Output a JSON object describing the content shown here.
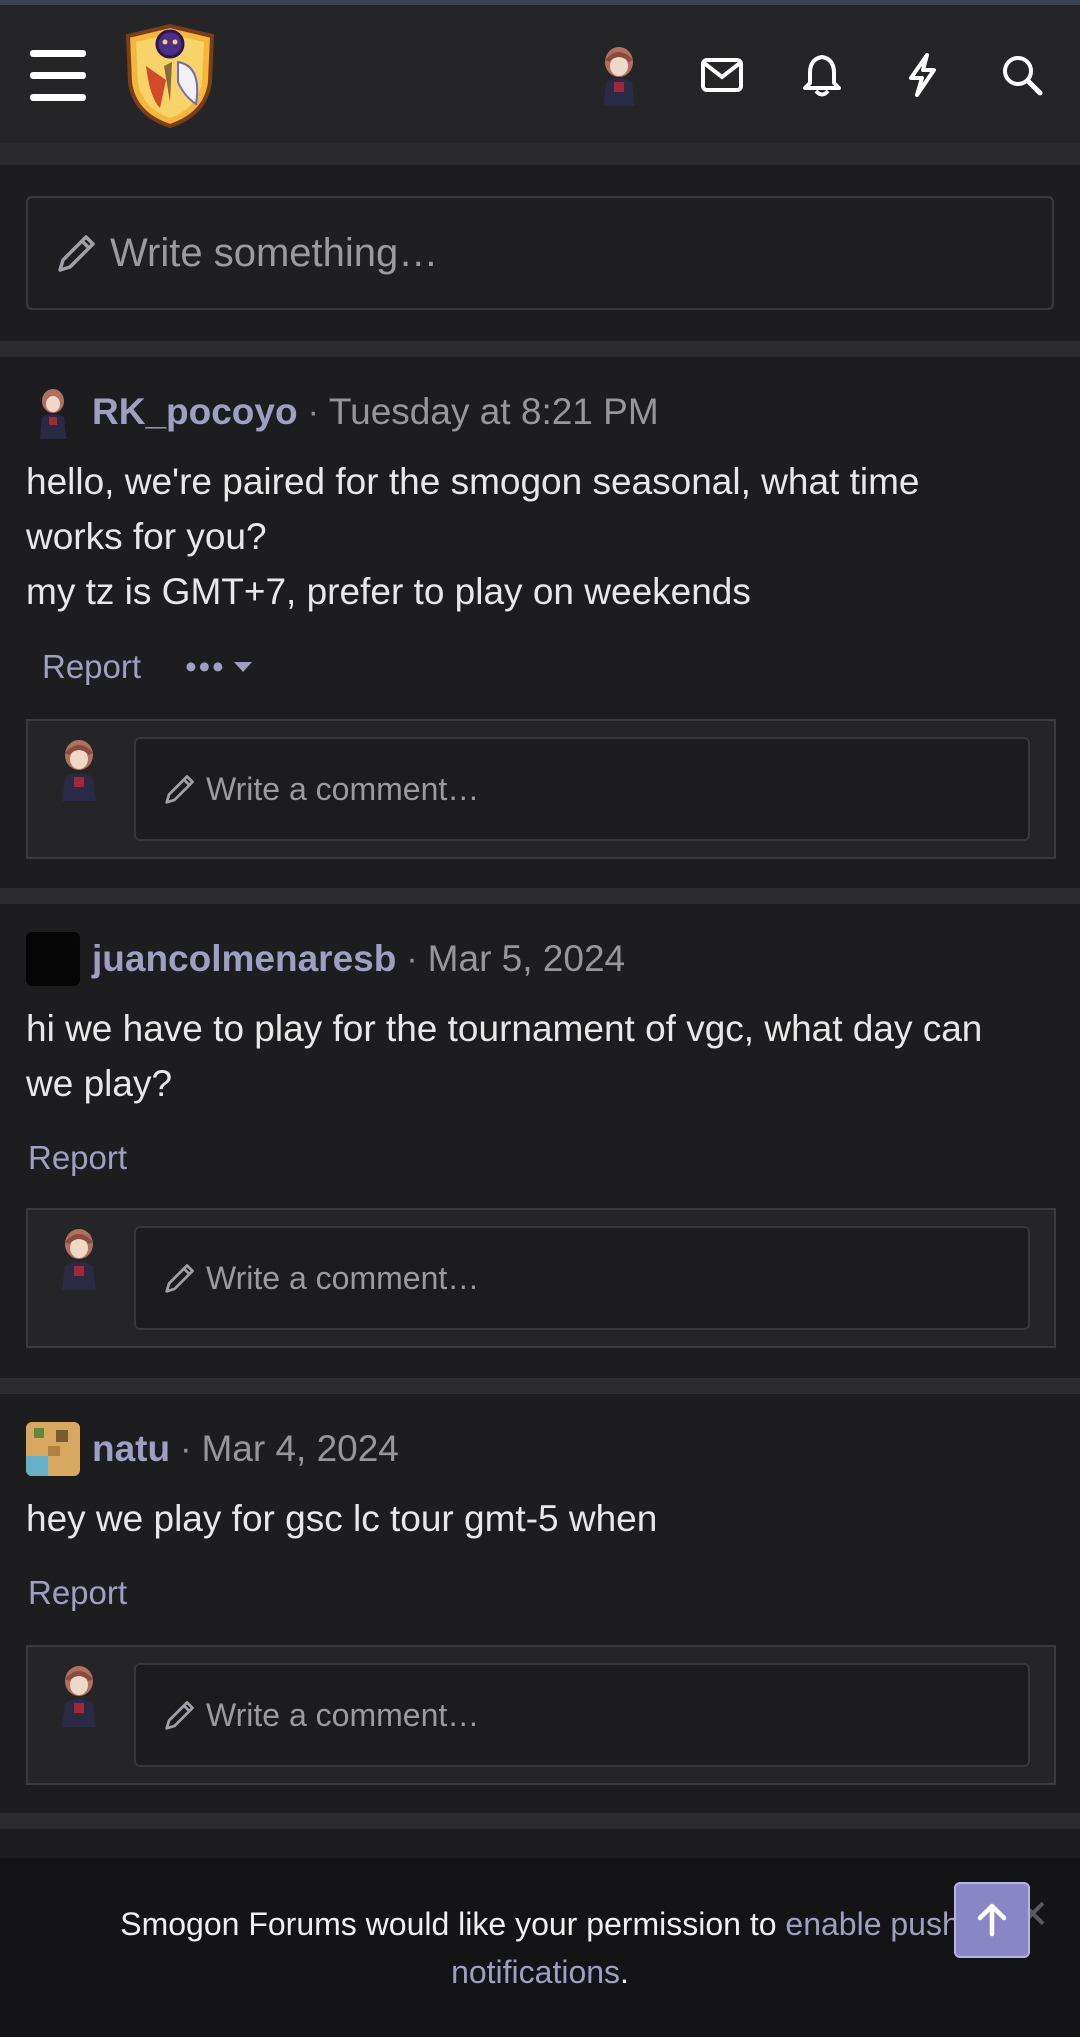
{
  "header": {
    "icons": [
      "menu-icon",
      "site-logo",
      "user-avatar",
      "envelope-icon",
      "bell-icon",
      "bolt-icon",
      "search-icon"
    ]
  },
  "composer": {
    "placeholder": "Write something…"
  },
  "posts": [
    {
      "username": "RK_pocoyo",
      "separator": "·",
      "date": "Tuesday at 8:21 PM",
      "body_lines": [
        "hello, we're paired for the smogon seasonal, what time",
        "works for you?",
        "my tz is GMT+7, prefer to play on weekends"
      ],
      "report_label": "Report",
      "more_label": "•••",
      "comment_placeholder": "Write a comment…"
    },
    {
      "username": "juancolmenaresb",
      "separator": "·",
      "date": "Mar 5, 2024",
      "body_lines": [
        "hi we have to play for the tournament of vgc, what day can",
        "we play?"
      ],
      "report_label": "Report",
      "comment_placeholder": "Write a comment…"
    },
    {
      "username": "natu",
      "separator": "·",
      "date": "Mar 4, 2024",
      "body_lines": [
        "hey we play for gsc lc tour gmt-5 when"
      ],
      "report_label": "Report",
      "comment_placeholder": "Write a comment…"
    }
  ],
  "notification": {
    "text_before": "Smogon Forums would like your permission to ",
    "link_line1": "enable push",
    "link_line2": "notifications",
    "text_after": ".",
    "close_label": "✕"
  },
  "colors": {
    "background": "#1d1d1f",
    "header": "#252527",
    "accent": "#9f9fc4",
    "scroll_button": "#8a86c6"
  }
}
